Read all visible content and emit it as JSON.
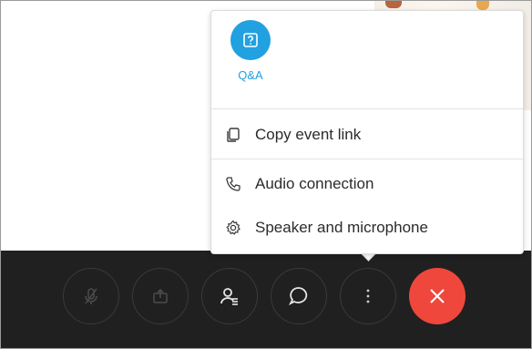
{
  "menu": {
    "qa_tile": {
      "label": "Q&A",
      "icon": "question-icon"
    },
    "items": [
      {
        "label": "Copy event link",
        "icon": "copy-icon"
      },
      {
        "label": "Audio connection",
        "icon": "phone-icon"
      },
      {
        "label": "Speaker and microphone",
        "icon": "gear-icon"
      }
    ]
  },
  "toolbar": {
    "buttons": [
      {
        "icon": "microphone-muted-icon"
      },
      {
        "icon": "share-icon"
      },
      {
        "icon": "participants-icon"
      },
      {
        "icon": "chat-icon"
      },
      {
        "icon": "more-options-icon"
      },
      {
        "icon": "leave-icon"
      }
    ]
  },
  "colors": {
    "accent": "#21a1e0",
    "end_call": "#f0473d",
    "toolbar_bg": "#202020"
  }
}
